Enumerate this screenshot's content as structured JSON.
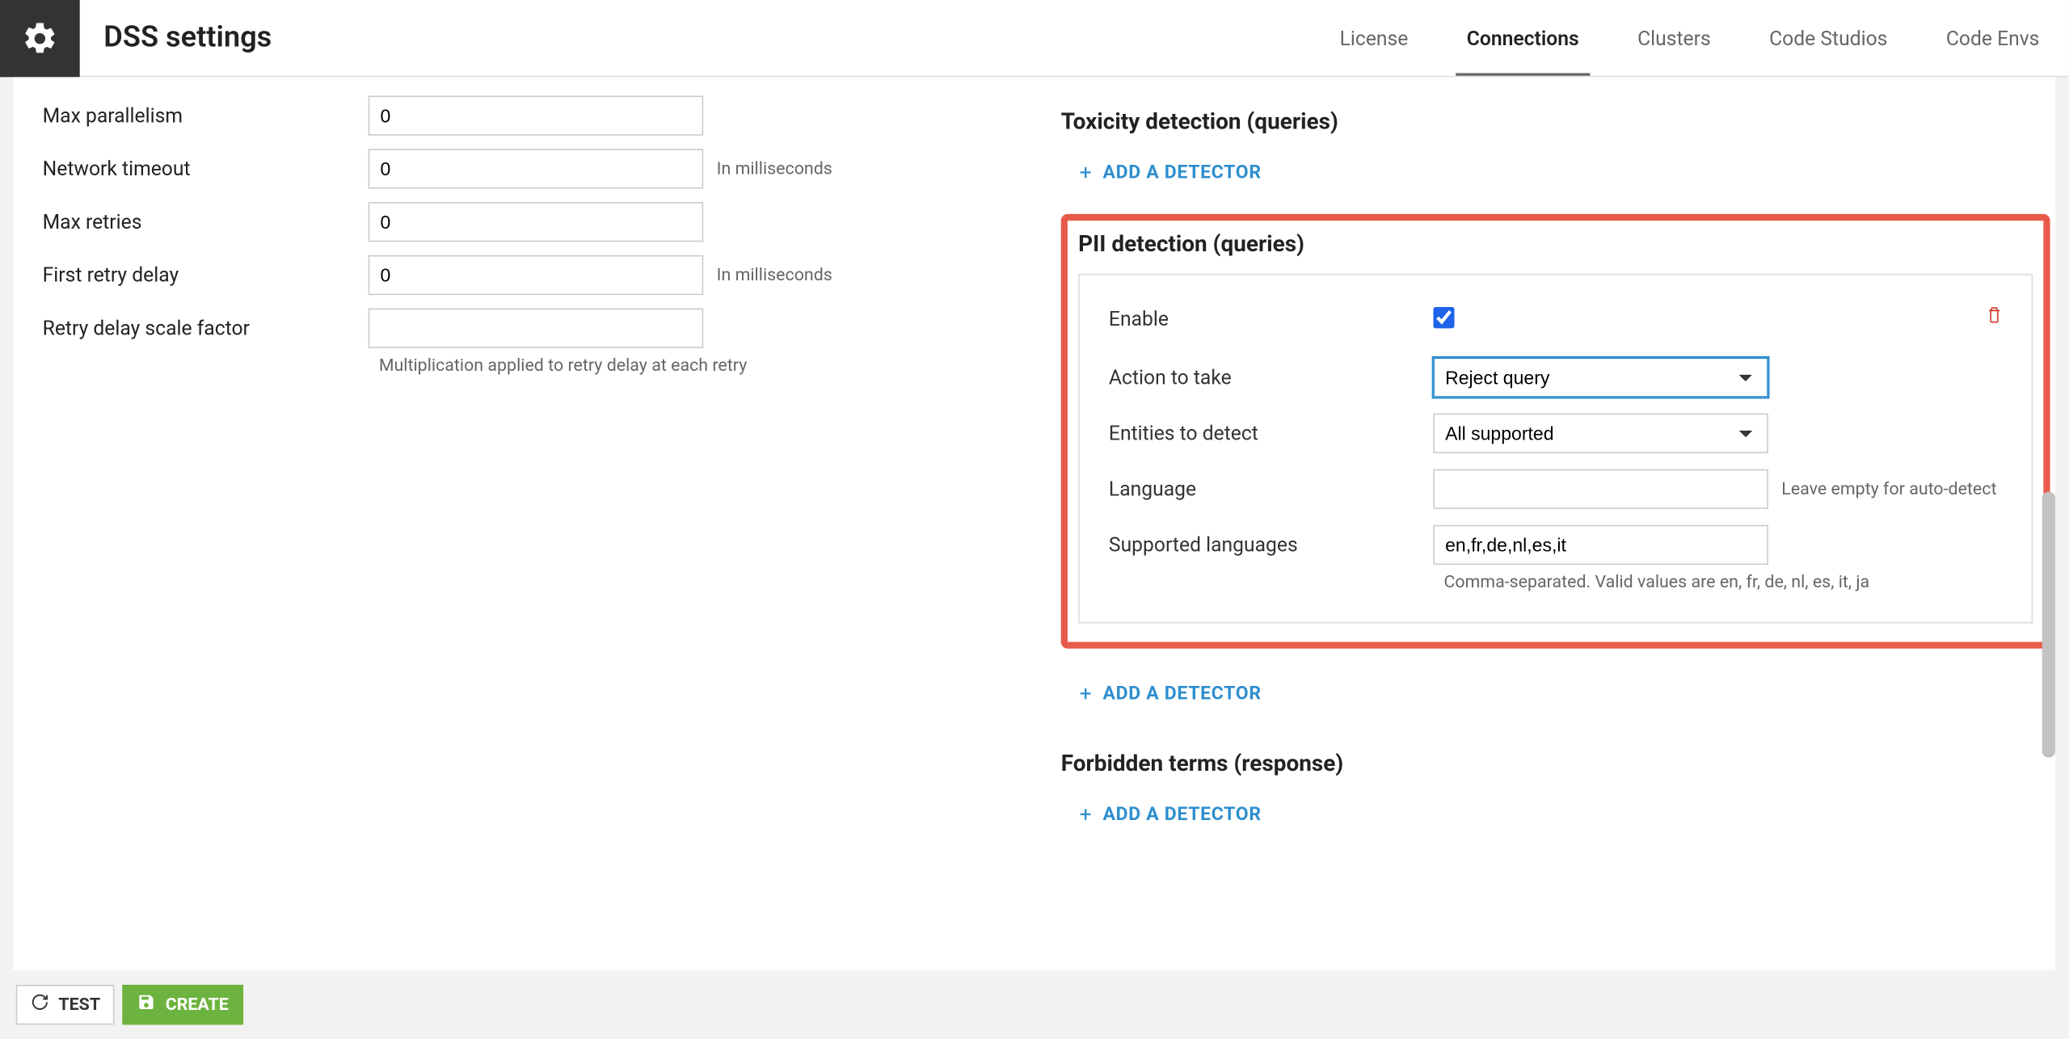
{
  "header": {
    "title": "DSS settings"
  },
  "tabs": [
    {
      "label": "License",
      "active": false
    },
    {
      "label": "Connections",
      "active": true
    },
    {
      "label": "Clusters",
      "active": false
    },
    {
      "label": "Code Studios",
      "active": false
    },
    {
      "label": "Code Envs",
      "active": false
    }
  ],
  "left_form": {
    "max_parallelism": {
      "label": "Max parallelism",
      "value": "0"
    },
    "network_timeout": {
      "label": "Network timeout",
      "value": "0",
      "hint": "In milliseconds"
    },
    "max_retries": {
      "label": "Max retries",
      "value": "0"
    },
    "first_retry_delay": {
      "label": "First retry delay",
      "value": "0",
      "hint": "In milliseconds"
    },
    "retry_delay_scale": {
      "label": "Retry delay scale factor",
      "value": "",
      "help": "Multiplication applied to retry delay at each retry"
    }
  },
  "right": {
    "toxicity_title": "Toxicity detection (queries)",
    "pii_title": "PII detection (queries)",
    "forbidden_title": "Forbidden terms (response)",
    "add_detector_label": "ADD A DETECTOR"
  },
  "pii": {
    "enable_label": "Enable",
    "enable_checked": true,
    "action_label": "Action to take",
    "action_value": "Reject query",
    "entities_label": "Entities to detect",
    "entities_value": "All supported",
    "language_label": "Language",
    "language_value": "",
    "language_hint": "Leave empty for auto-detect",
    "supported_label": "Supported languages",
    "supported_value": "en,fr,de,nl,es,it",
    "supported_help": "Comma-separated. Valid values are en, fr, de, nl, es, it, ja"
  },
  "buttons": {
    "test": "TEST",
    "create": "CREATE"
  }
}
